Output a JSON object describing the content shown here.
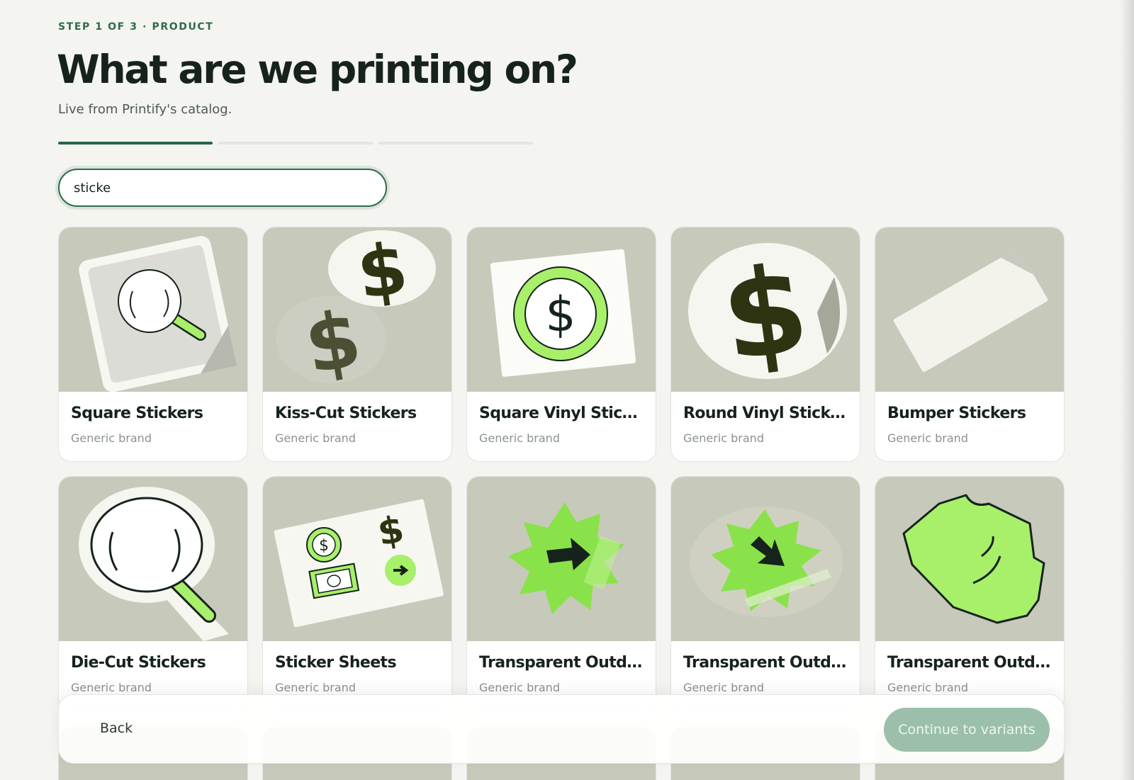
{
  "header": {
    "eyebrow": "STEP 1 OF 3 · PRODUCT",
    "title": "What are we printing on?",
    "subtitle": "Live from Printify's catalog."
  },
  "progress": {
    "current_step": 1,
    "total_steps": 3
  },
  "search": {
    "value": "sticke",
    "placeholder": ""
  },
  "products": [
    {
      "name": "Square Stickers",
      "brand": "Generic brand",
      "icon": "square-magnifier-sticker-icon"
    },
    {
      "name": "Kiss-Cut Stickers",
      "brand": "Generic brand",
      "icon": "dollar-kiss-cut-sticker-icon"
    },
    {
      "name": "Square Vinyl Stickers",
      "brand": "Generic brand",
      "icon": "dollar-coin-vinyl-sticker-icon"
    },
    {
      "name": "Round Vinyl Stickers",
      "brand": "Generic brand",
      "icon": "round-dollar-sticker-icon"
    },
    {
      "name": "Bumper Stickers",
      "brand": "Generic brand",
      "icon": "blank-bumper-sticker-icon"
    },
    {
      "name": "Die-Cut Stickers",
      "brand": "Generic brand",
      "icon": "magnifier-die-cut-sticker-icon"
    },
    {
      "name": "Sticker Sheets",
      "brand": "Generic brand",
      "icon": "sticker-sheet-icon"
    },
    {
      "name": "Transparent Outdo…",
      "brand": "Generic brand",
      "icon": "starburst-arrow-right-sticker-icon"
    },
    {
      "name": "Transparent Outdo…",
      "brand": "Generic brand",
      "icon": "starburst-arrow-down-sticker-icon"
    },
    {
      "name": "Transparent Outdo…",
      "brand": "Generic brand",
      "icon": "tshirt-sticker-icon"
    }
  ],
  "footer": {
    "back_label": "Back",
    "continue_label": "Continue to variants"
  },
  "colors": {
    "accent": "#25664a",
    "lime": "#a8ef6a",
    "thumb_bg": "#c7c9ba",
    "ink": "#16231c",
    "continue_disabled": "#9bbfaa"
  }
}
